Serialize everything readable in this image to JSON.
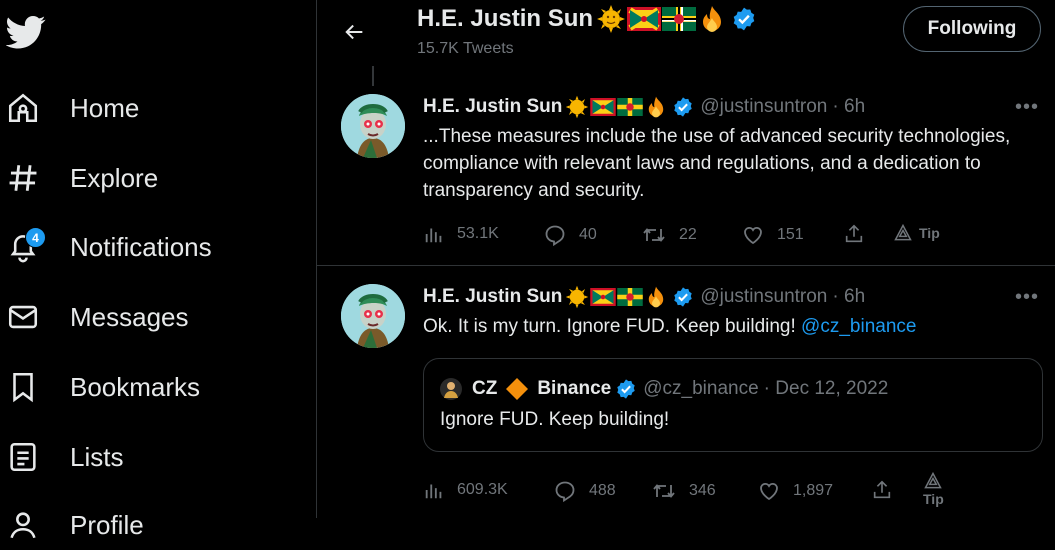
{
  "sidebar": {
    "items": [
      {
        "label": "Home",
        "icon": "home-icon"
      },
      {
        "label": "Explore",
        "icon": "hashtag-icon"
      },
      {
        "label": "Notifications",
        "icon": "bell-icon",
        "badge": "4"
      },
      {
        "label": "Messages",
        "icon": "envelope-icon"
      },
      {
        "label": "Bookmarks",
        "icon": "bookmark-icon"
      },
      {
        "label": "Lists",
        "icon": "list-icon"
      },
      {
        "label": "Profile",
        "icon": "person-icon"
      }
    ]
  },
  "header": {
    "name": "H.E. Justin Sun",
    "tweet_count": "15.7K Tweets",
    "follow_label": "Following"
  },
  "tweets": [
    {
      "name": "H.E. Justin Sun",
      "handle": "@justinsuntron",
      "time": "· 6h",
      "text": "...These measures include the use of advanced security technologies, compliance with relevant laws and regulations, and a dedication to transparency and security.",
      "views": "53.1K",
      "replies": "40",
      "retweets": "22",
      "likes": "151",
      "tip": "Tip"
    },
    {
      "name": "H.E. Justin Sun",
      "handle": "@justinsuntron",
      "time": "· 6h",
      "text": "Ok. It is my turn. Ignore FUD. Keep building!",
      "mention": "@cz_binance",
      "views": "609.3K",
      "replies": "488",
      "retweets": "346",
      "likes": "1,897",
      "tip": "Tip",
      "quote": {
        "name_part1": "CZ",
        "name_part2": "Binance",
        "handle": "@cz_binance",
        "date": "· Dec 12, 2022",
        "text": "Ignore FUD. Keep building!"
      }
    }
  ],
  "colors": {
    "accent": "#1d9bf0",
    "text": "#e7e9ea",
    "muted": "#71767b",
    "border": "#2f3336"
  }
}
